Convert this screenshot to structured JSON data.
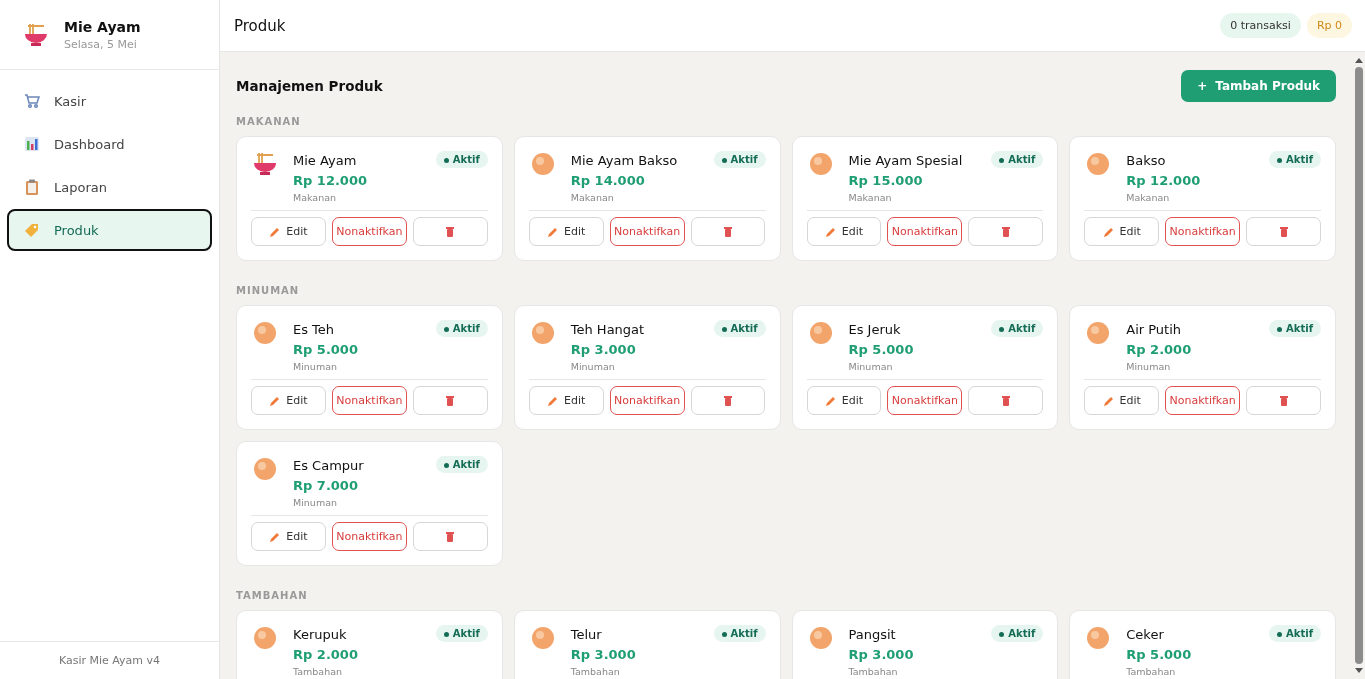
{
  "sidebar": {
    "brand": {
      "title": "Mie Ayam",
      "subtitle": "Selasa, 5 Mei"
    },
    "items": [
      {
        "label": "Kasir",
        "selected": false
      },
      {
        "label": "Dashboard",
        "selected": false
      },
      {
        "label": "Laporan",
        "selected": false
      },
      {
        "label": "Produk",
        "selected": true
      }
    ],
    "footer": "Kasir Mie Ayam v4"
  },
  "header": {
    "title": "Produk",
    "transactions": "0 transaksi",
    "total": "Rp 0"
  },
  "page": {
    "title": "Manajemen Produk",
    "add_button": "Tambah Produk",
    "add_icon": "+"
  },
  "sections": [
    {
      "title": "MAKANAN",
      "products": [
        {
          "name": "Mie Ayam",
          "price": "Rp 12.000",
          "category": "Makanan",
          "status": "Aktif",
          "active": true,
          "edit": "Edit",
          "toggle": "Nonaktifkan"
        },
        {
          "name": "Mie Ayam Bakso",
          "price": "Rp 14.000",
          "category": "Makanan",
          "status": "Aktif",
          "active": true,
          "edit": "Edit",
          "toggle": "Nonaktifkan"
        },
        {
          "name": "Mie Ayam Spesial",
          "price": "Rp 15.000",
          "category": "Makanan",
          "status": "Aktif",
          "active": true,
          "edit": "Edit",
          "toggle": "Nonaktifkan"
        },
        {
          "name": "Bakso",
          "price": "Rp 12.000",
          "category": "Makanan",
          "status": "Aktif",
          "active": true,
          "edit": "Edit",
          "toggle": "Nonaktifkan"
        }
      ]
    },
    {
      "title": "MINUMAN",
      "products": [
        {
          "name": "Es Teh",
          "price": "Rp 5.000",
          "category": "Minuman",
          "status": "Aktif",
          "active": true,
          "edit": "Edit",
          "toggle": "Nonaktifkan"
        },
        {
          "name": "Teh Hangat",
          "price": "Rp 3.000",
          "category": "Minuman",
          "status": "Aktif",
          "active": true,
          "edit": "Edit",
          "toggle": "Nonaktifkan"
        },
        {
          "name": "Es Jeruk",
          "price": "Rp 5.000",
          "category": "Minuman",
          "status": "Aktif",
          "active": true,
          "edit": "Edit",
          "toggle": "Nonaktifkan"
        },
        {
          "name": "Air Putih",
          "price": "Rp 2.000",
          "category": "Minuman",
          "status": "Aktif",
          "active": true,
          "edit": "Edit",
          "toggle": "Nonaktifkan"
        },
        {
          "name": "Es Campur",
          "price": "Rp 7.000",
          "category": "Minuman",
          "status": "Aktif",
          "active": true,
          "edit": "Edit",
          "toggle": "Nonaktifkan"
        }
      ]
    },
    {
      "title": "TAMBAHAN",
      "products": [
        {
          "name": "Kerupuk",
          "price": "Rp 2.000",
          "category": "Tambahan",
          "status": "Aktif",
          "active": true
        },
        {
          "name": "Telur",
          "price": "Rp 3.000",
          "category": "Tambahan",
          "status": "Aktif",
          "active": true
        },
        {
          "name": "Pangsit",
          "price": "Rp 3.000",
          "category": "Tambahan",
          "status": "Aktif",
          "active": true
        },
        {
          "name": "Ceker",
          "price": "Rp 5.000",
          "category": "Tambahan",
          "status": "Aktif",
          "active": true
        }
      ]
    }
  ]
}
